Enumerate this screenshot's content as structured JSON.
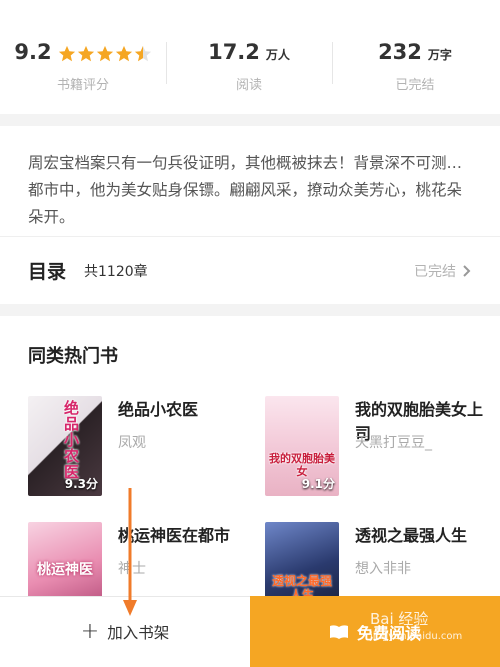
{
  "stats": [
    {
      "value": "9.2",
      "unit": "",
      "label": "书籍评分",
      "rating_stars": 4.5
    },
    {
      "value": "17.2",
      "unit": "万人",
      "label": "阅读"
    },
    {
      "value": "232",
      "unit": "万字",
      "label": "已完结"
    }
  ],
  "description": "周宏宝档案只有一句兵役证明，其他概被抹去！背景深不可测…都市中，他为美女贴身保镖。翩翩风采，撩动众美芳心，桃花朵朵开。",
  "toc": {
    "title": "目录",
    "count": "共1120章",
    "status": "已完结"
  },
  "similar": {
    "title": "同类热门书",
    "books": [
      {
        "name": "绝品小农医",
        "author": "凤观",
        "cover_title": "绝品小农医",
        "cover_score": "9.3分"
      },
      {
        "name": "我的双胞胎美女上司",
        "author": "天黑打豆豆_",
        "cover_title": "我的双胞胎美女",
        "cover_score": "9.1分"
      },
      {
        "name": "桃运神医在都市",
        "author": "神士",
        "cover_title": "桃运神医"
      },
      {
        "name": "透视之最强人生",
        "author": "想入非非",
        "cover_title": "透视之最强人生"
      }
    ]
  },
  "bottom": {
    "add_shelf": "加入书架",
    "read_free": "免费阅读"
  },
  "watermark": {
    "line1": "Bai 经验",
    "line2": "jingyan.baidu.com"
  },
  "colors": {
    "accent": "#f5a623",
    "star": "#f5a623"
  }
}
